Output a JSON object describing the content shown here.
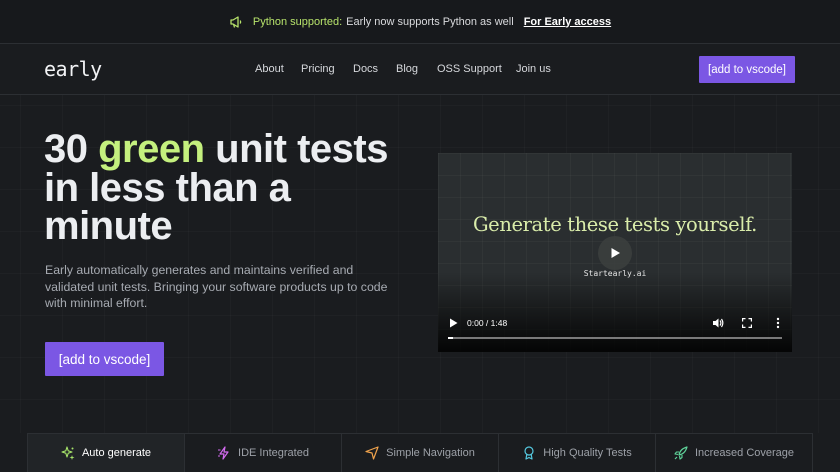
{
  "banner": {
    "highlight": "Python supported:",
    "text": "Early now supports Python as well",
    "cta": "For Early access",
    "icon": "megaphone-icon"
  },
  "nav": {
    "logo": "early",
    "links": [
      "About",
      "Pricing",
      "Docs",
      "Blog",
      "OSS Support",
      "Join us"
    ],
    "cta": "[add to vscode]"
  },
  "hero": {
    "title_pre": "30 ",
    "title_green": "green",
    "title_post": " unit tests in less than a minute",
    "description": "Early automatically generates and maintains verified and validated unit tests. Bringing your software products up to code with minimal effort.",
    "cta": "[add to vscode]"
  },
  "video": {
    "headline": "Generate these tests yourself.",
    "subtitle": "Startearly.ai",
    "time": "0:00 / 1:48",
    "progress": 0.015
  },
  "features": {
    "tabs": [
      {
        "label": "Auto generate",
        "icon": "sparkles-icon",
        "color": "#a6e36a",
        "active": true
      },
      {
        "label": "IDE Integrated",
        "icon": "lightning-icon",
        "color": "#d46bf0",
        "active": false
      },
      {
        "label": "Simple Navigation",
        "icon": "navigation-arrow-icon",
        "color": "#f0a34c",
        "active": false
      },
      {
        "label": "High Quality Tests",
        "icon": "award-badge-icon",
        "color": "#55c9e0",
        "active": false
      },
      {
        "label": "Increased Coverage",
        "icon": "rocket-icon",
        "color": "#5fd39a",
        "active": false
      }
    ]
  },
  "colors": {
    "accent": "#7b57e4",
    "green": "#c4f07e",
    "background": "#1a1c1f"
  }
}
